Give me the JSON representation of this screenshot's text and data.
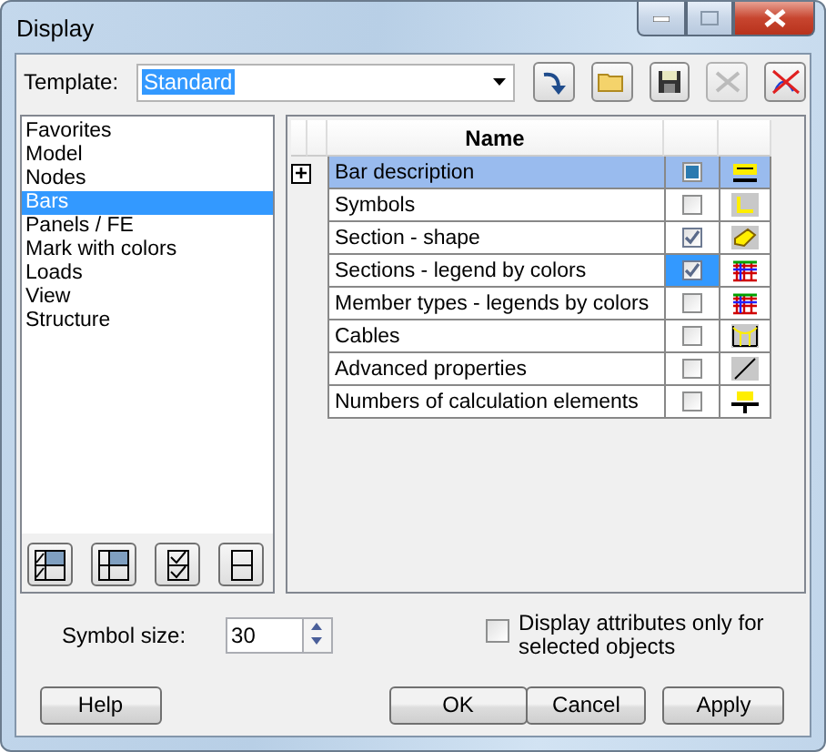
{
  "window": {
    "title": "Display"
  },
  "template": {
    "label": "Template:",
    "value": "Standard"
  },
  "categories": [
    {
      "label": "Favorites",
      "selected": false
    },
    {
      "label": "Model",
      "selected": false
    },
    {
      "label": "Nodes",
      "selected": false
    },
    {
      "label": "Bars",
      "selected": true
    },
    {
      "label": "Panels / FE",
      "selected": false
    },
    {
      "label": "Mark with colors",
      "selected": false
    },
    {
      "label": "Loads",
      "selected": false
    },
    {
      "label": "View",
      "selected": false
    },
    {
      "label": "Structure",
      "selected": false
    }
  ],
  "table": {
    "columns": [
      "Name"
    ],
    "rows": [
      {
        "expander": "+",
        "name": "Bar description",
        "selected": true,
        "checked": false,
        "partial": true,
        "focused": false
      },
      {
        "name": "Symbols",
        "selected": false,
        "checked": false,
        "partial": false,
        "focused": false
      },
      {
        "name": "Section - shape",
        "selected": false,
        "checked": true,
        "partial": false,
        "focused": false
      },
      {
        "name": "Sections - legend by colors",
        "selected": false,
        "checked": true,
        "partial": false,
        "focused": true
      },
      {
        "name": "Member types - legends by colors",
        "selected": false,
        "checked": false,
        "partial": false,
        "focused": false
      },
      {
        "name": "Cables",
        "selected": false,
        "checked": false,
        "partial": false,
        "focused": false
      },
      {
        "name": "Advanced properties",
        "selected": false,
        "checked": false,
        "partial": false,
        "focused": false
      },
      {
        "name": "Numbers of calculation elements",
        "selected": false,
        "checked": false,
        "partial": false,
        "focused": false
      }
    ]
  },
  "symbol_size": {
    "label": "Symbol size:",
    "value": "30"
  },
  "selected_only": {
    "label": "Display attributes only for selected objects",
    "checked": false
  },
  "buttons": [
    "Help",
    "OK",
    "Cancel",
    "Apply"
  ]
}
